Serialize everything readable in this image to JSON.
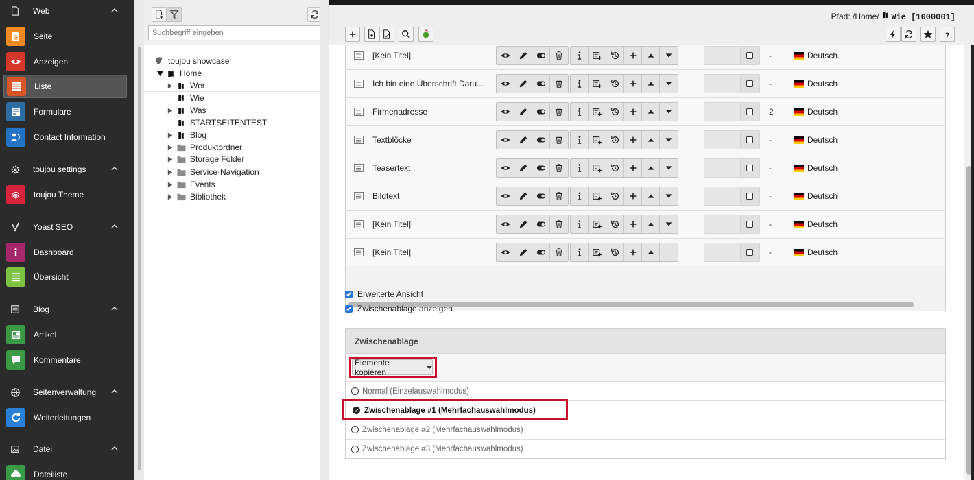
{
  "module_menu": {
    "groups": [
      {
        "label": "Web",
        "icon": "page-icon",
        "items": [
          {
            "label": "Seite",
            "icon": "page-icon",
            "color": "#f28b24"
          },
          {
            "label": "Anzeigen",
            "icon": "eye-icon",
            "color": "#d6372c"
          },
          {
            "label": "Liste",
            "icon": "list-icon",
            "color": "#d9562b",
            "active": true
          },
          {
            "label": "Formulare",
            "icon": "form-icon",
            "color": "#2c6ea5"
          },
          {
            "label": "Contact Information",
            "icon": "contact-icon",
            "color": "#2374c6"
          }
        ]
      },
      {
        "label": "toujou settings",
        "icon": "gear-icon",
        "items": [
          {
            "label": "toujou Theme",
            "icon": "fingerprint-icon",
            "color": "#d6243c"
          }
        ]
      },
      {
        "label": "Yoast SEO",
        "icon": "yoast-icon",
        "items": [
          {
            "label": "Dashboard",
            "icon": "info-icon",
            "color": "#a4286a"
          },
          {
            "label": "Übersicht",
            "icon": "overview-icon",
            "color": "#7dc243"
          }
        ]
      },
      {
        "label": "Blog",
        "icon": "blog-icon",
        "items": [
          {
            "label": "Artikel",
            "icon": "article-icon",
            "color": "#3b9a46"
          },
          {
            "label": "Kommentare",
            "icon": "comment-icon",
            "color": "#3b9a46"
          }
        ]
      },
      {
        "label": "Seitenverwaltung",
        "icon": "globe-icon",
        "items": [
          {
            "label": "Weiterleitungen",
            "icon": "redirect-icon",
            "color": "#2980d9"
          }
        ]
      },
      {
        "label": "Datei",
        "icon": "image-icon",
        "items": [
          {
            "label": "Dateiliste",
            "icon": "cloud-icon",
            "color": "#3b9a46"
          }
        ]
      }
    ]
  },
  "tree": {
    "search_placeholder": "Suchbegriff eingeben",
    "root": "toujou showcase",
    "nodes": [
      {
        "label": "Home"
      },
      {
        "label": "Wer"
      },
      {
        "label": "Wie"
      },
      {
        "label": "Was"
      },
      {
        "label": "STARTSEITENTEST"
      },
      {
        "label": "Blog"
      },
      {
        "label": "Produktordner"
      },
      {
        "label": "Storage Folder"
      },
      {
        "label": "Service-Navigation"
      },
      {
        "label": "Events"
      },
      {
        "label": "Bibliothek"
      }
    ]
  },
  "header": {
    "path_prefix": "Pfad: /Home/",
    "path_page": "Wie [1000001]"
  },
  "records": [
    {
      "title": "[Kein Titel]",
      "num": "-",
      "lang": "Deutsch"
    },
    {
      "title": "Ich bin eine Überschrift Daru...",
      "num": "-",
      "lang": "Deutsch"
    },
    {
      "title": "Firmenadresse",
      "num": "2",
      "lang": "Deutsch"
    },
    {
      "title": "Textblöcke",
      "num": "-",
      "lang": "Deutsch"
    },
    {
      "title": "Teasertext",
      "num": "-",
      "lang": "Deutsch"
    },
    {
      "title": "Bildtext",
      "num": "-",
      "lang": "Deutsch"
    },
    {
      "title": "[Kein Titel]",
      "num": "-",
      "lang": "Deutsch"
    },
    {
      "title": "[Kein Titel]",
      "num": "-",
      "lang": "Deutsch"
    }
  ],
  "options": {
    "extended_view": "Erweiterte Ansicht",
    "show_clipboard": "Zwischenablage anzeigen"
  },
  "clipboard": {
    "title": "Zwischenablage",
    "copy_button": "Elemente kopieren",
    "modes": [
      {
        "label": "Normal (Einzelauswahlmodus)",
        "active": false
      },
      {
        "label": "Zwischenablage #1 (Mehrfachauswahlmodus)",
        "active": true
      },
      {
        "label": "Zwischenablage #2 (Mehrfachauswahlmodus)",
        "active": false
      },
      {
        "label": "Zwischenablage #3 (Mehrfachauswahlmodus)",
        "active": false
      }
    ]
  }
}
